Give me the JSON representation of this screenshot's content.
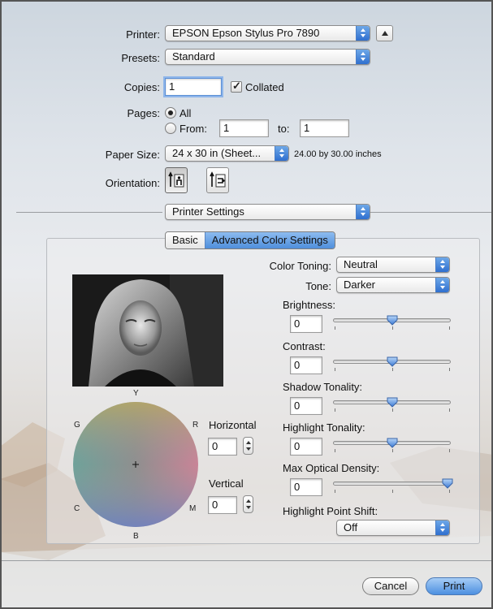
{
  "printer": {
    "label": "Printer:",
    "value": "EPSON Epson Stylus Pro 7890"
  },
  "presets": {
    "label": "Presets:",
    "value": "Standard"
  },
  "copies": {
    "label": "Copies:",
    "value": "1",
    "collated_label": "Collated",
    "collated_checked": true
  },
  "pages": {
    "label": "Pages:",
    "all_label": "All",
    "from_label": "From:",
    "from_value": "1",
    "to_label": "to:",
    "to_value": "1",
    "selected": "All"
  },
  "paper_size": {
    "label": "Paper Size:",
    "value": "24 x 30 in (Sheet...",
    "dimensions": "24.00 by 30.00 inches"
  },
  "orientation": {
    "label": "Orientation:",
    "options": [
      "portrait",
      "landscape"
    ],
    "selected": "portrait"
  },
  "section_popup": {
    "value": "Printer Settings"
  },
  "tabs": [
    {
      "label": "Basic",
      "selected": false
    },
    {
      "label": "Advanced Color Settings",
      "selected": true
    }
  ],
  "advanced": {
    "color_toning": {
      "label": "Color Toning:",
      "value": "Neutral"
    },
    "tone": {
      "label": "Tone:",
      "value": "Darker"
    },
    "sliders": [
      {
        "label": "Brightness:",
        "value": "0",
        "level": 0.5
      },
      {
        "label": "Contrast:",
        "value": "0",
        "level": 0.5
      },
      {
        "label": "Shadow Tonality:",
        "value": "0",
        "level": 0.5
      },
      {
        "label": "Highlight Tonality:",
        "value": "0",
        "level": 0.5
      },
      {
        "label": "Max Optical Density:",
        "value": "0",
        "level": 1.0
      }
    ],
    "highlight_point_shift": {
      "label": "Highlight Point Shift:",
      "value": "Off"
    },
    "color_wheel": {
      "labels": {
        "y": "Y",
        "g": "G",
        "r": "R",
        "c": "C",
        "m": "M",
        "b": "B"
      },
      "horizontal_label": "Horizontal",
      "horizontal_value": "0",
      "vertical_label": "Vertical",
      "vertical_value": "0"
    }
  },
  "footer": {
    "cancel": "Cancel",
    "print": "Print"
  },
  "colors": {
    "accent": "#4f8fdc",
    "focus": "#8fb6ea"
  }
}
